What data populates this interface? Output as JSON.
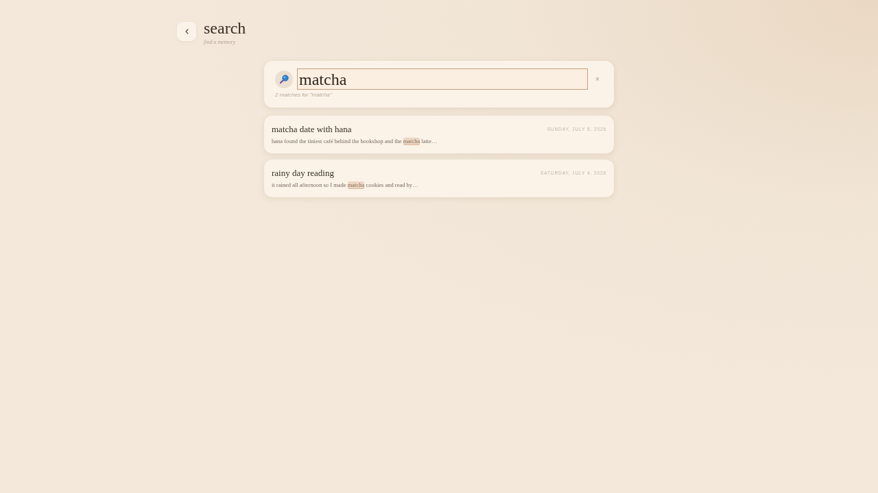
{
  "header": {
    "title": "search",
    "subtitle": "find a memory"
  },
  "search": {
    "value": "matcha",
    "focused": true,
    "clear": "×",
    "summary": "2 matches for \"matcha\""
  },
  "results": [
    {
      "title": "matcha date with hana",
      "date": "SUNDAY, JULY 5, 2026",
      "snippet": [
        {
          "text": "hana found the tiniest café behind the bookshop and the ",
          "highlight": false
        },
        {
          "text": "matcha",
          "highlight": true
        },
        {
          "text": " latte…",
          "highlight": false
        }
      ]
    },
    {
      "title": "rainy day reading",
      "date": "SATURDAY, JULY 4, 2026",
      "snippet": [
        {
          "text": "it rained all afternoon so I made ",
          "highlight": false
        },
        {
          "text": "matcha",
          "highlight": true
        },
        {
          "text": " cookies and read by…",
          "highlight": false
        }
      ]
    }
  ]
}
